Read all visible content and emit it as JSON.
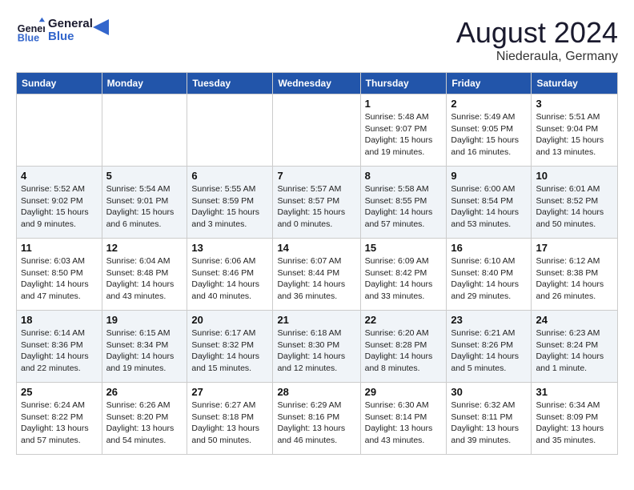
{
  "header": {
    "logo_text_general": "General",
    "logo_text_blue": "Blue",
    "month_title": "August 2024",
    "location": "Niederaula, Germany"
  },
  "calendar": {
    "days_of_week": [
      "Sunday",
      "Monday",
      "Tuesday",
      "Wednesday",
      "Thursday",
      "Friday",
      "Saturday"
    ],
    "weeks": [
      [
        {
          "day": "",
          "info": ""
        },
        {
          "day": "",
          "info": ""
        },
        {
          "day": "",
          "info": ""
        },
        {
          "day": "",
          "info": ""
        },
        {
          "day": "1",
          "info": "Sunrise: 5:48 AM\nSunset: 9:07 PM\nDaylight: 15 hours\nand 19 minutes."
        },
        {
          "day": "2",
          "info": "Sunrise: 5:49 AM\nSunset: 9:05 PM\nDaylight: 15 hours\nand 16 minutes."
        },
        {
          "day": "3",
          "info": "Sunrise: 5:51 AM\nSunset: 9:04 PM\nDaylight: 15 hours\nand 13 minutes."
        }
      ],
      [
        {
          "day": "4",
          "info": "Sunrise: 5:52 AM\nSunset: 9:02 PM\nDaylight: 15 hours\nand 9 minutes."
        },
        {
          "day": "5",
          "info": "Sunrise: 5:54 AM\nSunset: 9:01 PM\nDaylight: 15 hours\nand 6 minutes."
        },
        {
          "day": "6",
          "info": "Sunrise: 5:55 AM\nSunset: 8:59 PM\nDaylight: 15 hours\nand 3 minutes."
        },
        {
          "day": "7",
          "info": "Sunrise: 5:57 AM\nSunset: 8:57 PM\nDaylight: 15 hours\nand 0 minutes."
        },
        {
          "day": "8",
          "info": "Sunrise: 5:58 AM\nSunset: 8:55 PM\nDaylight: 14 hours\nand 57 minutes."
        },
        {
          "day": "9",
          "info": "Sunrise: 6:00 AM\nSunset: 8:54 PM\nDaylight: 14 hours\nand 53 minutes."
        },
        {
          "day": "10",
          "info": "Sunrise: 6:01 AM\nSunset: 8:52 PM\nDaylight: 14 hours\nand 50 minutes."
        }
      ],
      [
        {
          "day": "11",
          "info": "Sunrise: 6:03 AM\nSunset: 8:50 PM\nDaylight: 14 hours\nand 47 minutes."
        },
        {
          "day": "12",
          "info": "Sunrise: 6:04 AM\nSunset: 8:48 PM\nDaylight: 14 hours\nand 43 minutes."
        },
        {
          "day": "13",
          "info": "Sunrise: 6:06 AM\nSunset: 8:46 PM\nDaylight: 14 hours\nand 40 minutes."
        },
        {
          "day": "14",
          "info": "Sunrise: 6:07 AM\nSunset: 8:44 PM\nDaylight: 14 hours\nand 36 minutes."
        },
        {
          "day": "15",
          "info": "Sunrise: 6:09 AM\nSunset: 8:42 PM\nDaylight: 14 hours\nand 33 minutes."
        },
        {
          "day": "16",
          "info": "Sunrise: 6:10 AM\nSunset: 8:40 PM\nDaylight: 14 hours\nand 29 minutes."
        },
        {
          "day": "17",
          "info": "Sunrise: 6:12 AM\nSunset: 8:38 PM\nDaylight: 14 hours\nand 26 minutes."
        }
      ],
      [
        {
          "day": "18",
          "info": "Sunrise: 6:14 AM\nSunset: 8:36 PM\nDaylight: 14 hours\nand 22 minutes."
        },
        {
          "day": "19",
          "info": "Sunrise: 6:15 AM\nSunset: 8:34 PM\nDaylight: 14 hours\nand 19 minutes."
        },
        {
          "day": "20",
          "info": "Sunrise: 6:17 AM\nSunset: 8:32 PM\nDaylight: 14 hours\nand 15 minutes."
        },
        {
          "day": "21",
          "info": "Sunrise: 6:18 AM\nSunset: 8:30 PM\nDaylight: 14 hours\nand 12 minutes."
        },
        {
          "day": "22",
          "info": "Sunrise: 6:20 AM\nSunset: 8:28 PM\nDaylight: 14 hours\nand 8 minutes."
        },
        {
          "day": "23",
          "info": "Sunrise: 6:21 AM\nSunset: 8:26 PM\nDaylight: 14 hours\nand 5 minutes."
        },
        {
          "day": "24",
          "info": "Sunrise: 6:23 AM\nSunset: 8:24 PM\nDaylight: 14 hours\nand 1 minute."
        }
      ],
      [
        {
          "day": "25",
          "info": "Sunrise: 6:24 AM\nSunset: 8:22 PM\nDaylight: 13 hours\nand 57 minutes."
        },
        {
          "day": "26",
          "info": "Sunrise: 6:26 AM\nSunset: 8:20 PM\nDaylight: 13 hours\nand 54 minutes."
        },
        {
          "day": "27",
          "info": "Sunrise: 6:27 AM\nSunset: 8:18 PM\nDaylight: 13 hours\nand 50 minutes."
        },
        {
          "day": "28",
          "info": "Sunrise: 6:29 AM\nSunset: 8:16 PM\nDaylight: 13 hours\nand 46 minutes."
        },
        {
          "day": "29",
          "info": "Sunrise: 6:30 AM\nSunset: 8:14 PM\nDaylight: 13 hours\nand 43 minutes."
        },
        {
          "day": "30",
          "info": "Sunrise: 6:32 AM\nSunset: 8:11 PM\nDaylight: 13 hours\nand 39 minutes."
        },
        {
          "day": "31",
          "info": "Sunrise: 6:34 AM\nSunset: 8:09 PM\nDaylight: 13 hours\nand 35 minutes."
        }
      ]
    ]
  }
}
